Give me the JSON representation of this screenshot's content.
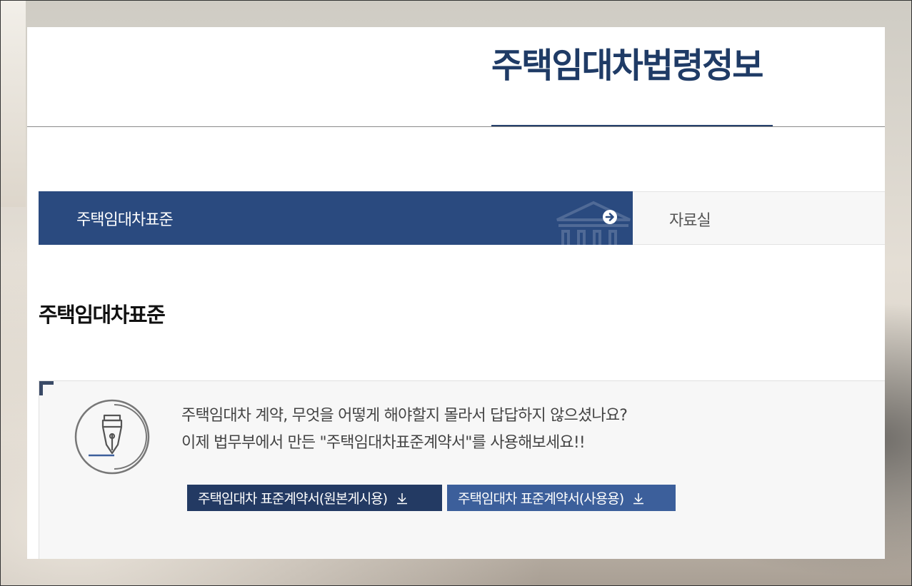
{
  "header": {
    "site_title": "주택임대차법령정보"
  },
  "tabs": [
    {
      "label": "주택임대차표준",
      "active": true
    },
    {
      "label": "자료실",
      "active": false
    }
  ],
  "section": {
    "title": "주택임대차표준"
  },
  "info": {
    "line1": "주택임대차 계약, 무엇을 어떻게 해야할지 몰라서 답답하지 않으셨나요?",
    "line2": "이제 법무부에서 만든 \"주택임대차표준계약서\"를 사용해보세요!!",
    "icon": "fountain-pen-icon"
  },
  "downloads": [
    {
      "label": "주택임대차 표준계약서(원본게시용)",
      "icon": "download-icon"
    },
    {
      "label": "주택임대차 표준계약서(사용용)",
      "icon": "download-icon"
    }
  ],
  "colors": {
    "title": "#1f3b66",
    "tab_active": "#2a4a7f",
    "button_dark": "#233a63",
    "button_light": "#3c5f9b"
  }
}
